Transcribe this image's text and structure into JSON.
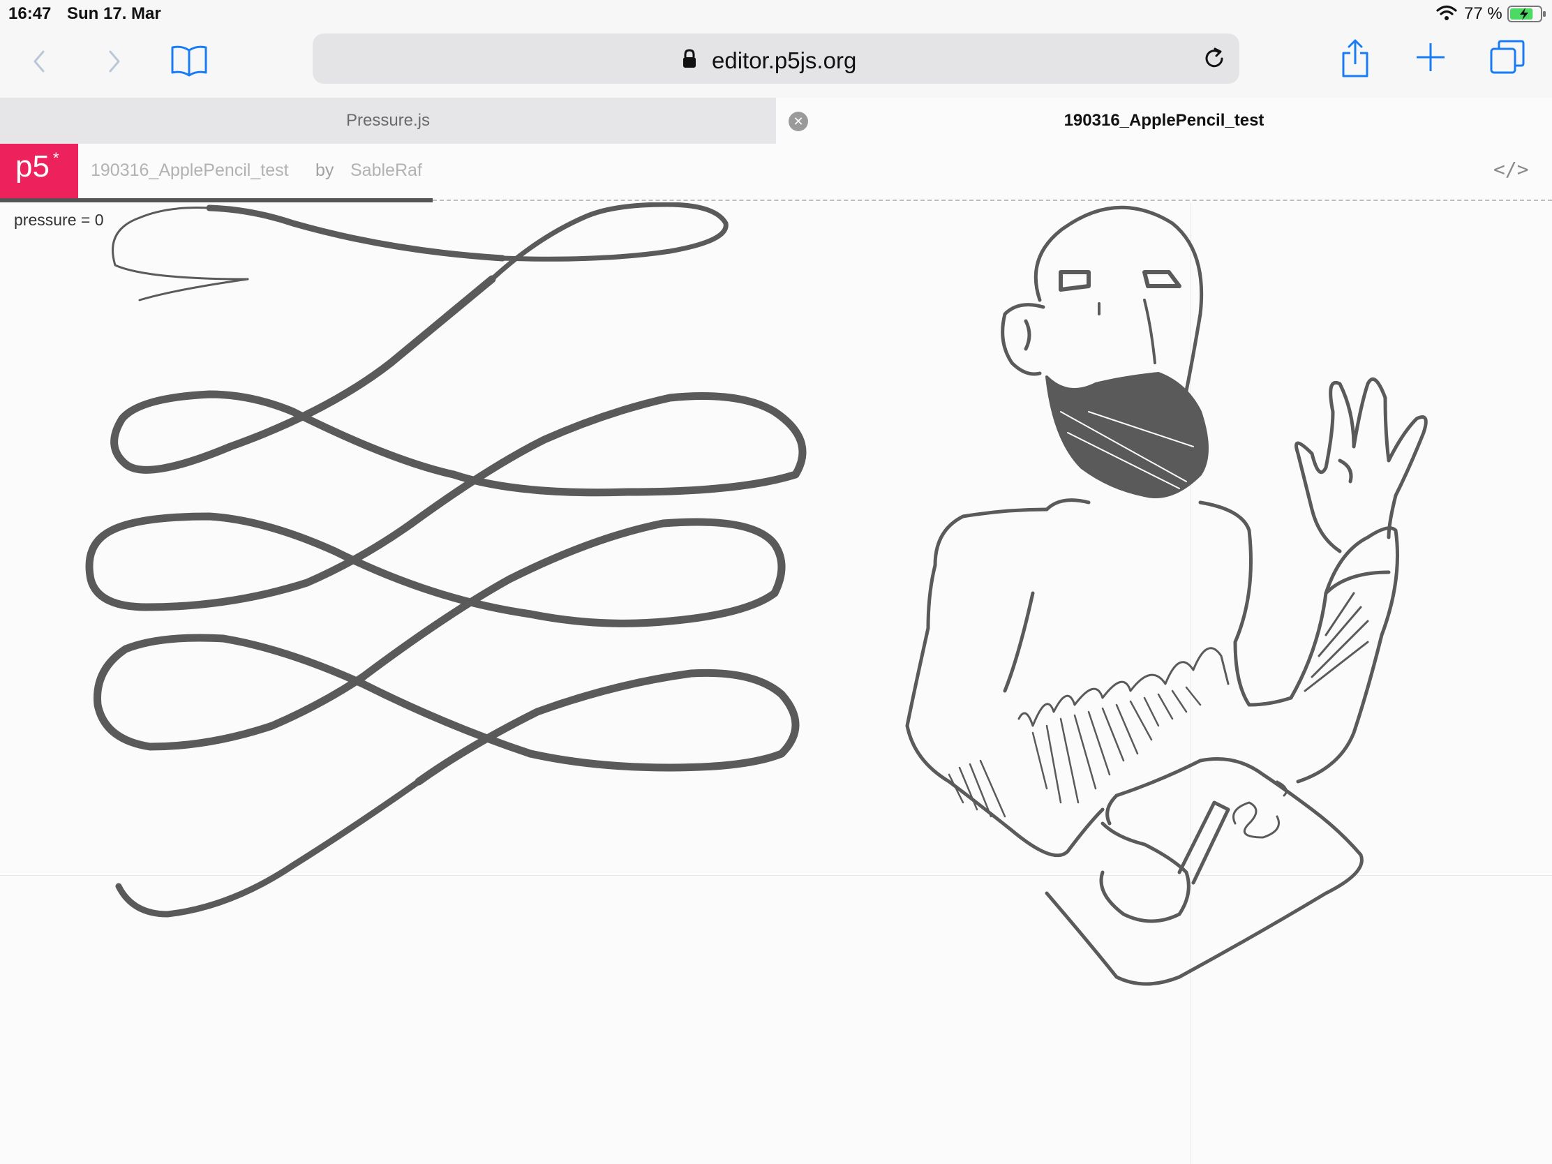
{
  "status_bar": {
    "time": "16:47",
    "date": "Sun 17. Mar",
    "battery_percent": "77 %",
    "battery_level": 0.77,
    "icons": [
      "wifi-icon",
      "battery-charging-icon"
    ]
  },
  "toolbar": {
    "url": "editor.p5js.org",
    "icons": [
      "back-icon",
      "forward-icon",
      "bookmarks-icon",
      "lock-icon",
      "reload-icon",
      "share-icon",
      "new-tab-icon",
      "tabs-overview-icon"
    ]
  },
  "tabs": [
    {
      "label": "Pressure.js",
      "active": false
    },
    {
      "label": "190316_ApplePencil_test",
      "active": true
    }
  ],
  "p5": {
    "logo_text": "p5",
    "logo_star": "*",
    "sketch_name": "190316_ApplePencil_test",
    "by_label": "by",
    "author": "SableRaf",
    "code_toggle": "</>"
  },
  "canvas": {
    "pressure_label": "pressure = 0"
  },
  "colors": {
    "p5_pink": "#ed225d",
    "ios_blue": "#1a7cf5",
    "stroke": "#5a5a5a",
    "battery_green": "#4cd964"
  }
}
